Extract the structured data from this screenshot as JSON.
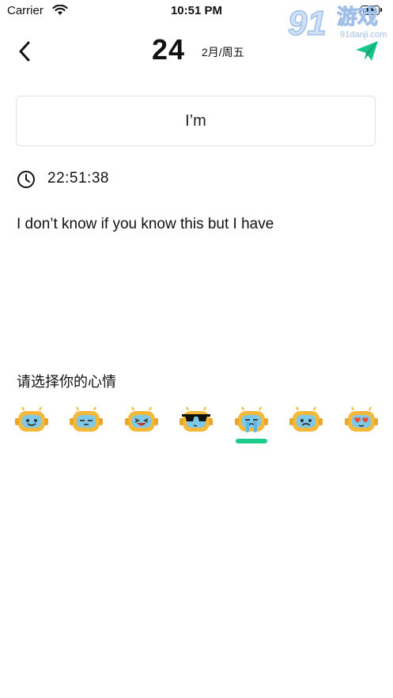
{
  "status_bar": {
    "carrier": "Carrier",
    "time": "10:51 PM"
  },
  "watermark": {
    "brand": "91游戏",
    "url": "91danji.com"
  },
  "header": {
    "day": "24",
    "month_weekday": "2月/周五"
  },
  "entry": {
    "title": "I’m",
    "time": "22:51:38",
    "body": "I don’t know if you know this but I have"
  },
  "mood": {
    "label": "请选择你的心情",
    "options": [
      "smile",
      "sleepy",
      "laugh",
      "cool",
      "cry",
      "sad",
      "love"
    ],
    "selected": "cry",
    "accent_color": "#1dcc8a"
  },
  "colors": {
    "send": "#19c48a",
    "mood_face": "#f4b93a",
    "mood_screen": "#7ec9e8"
  }
}
